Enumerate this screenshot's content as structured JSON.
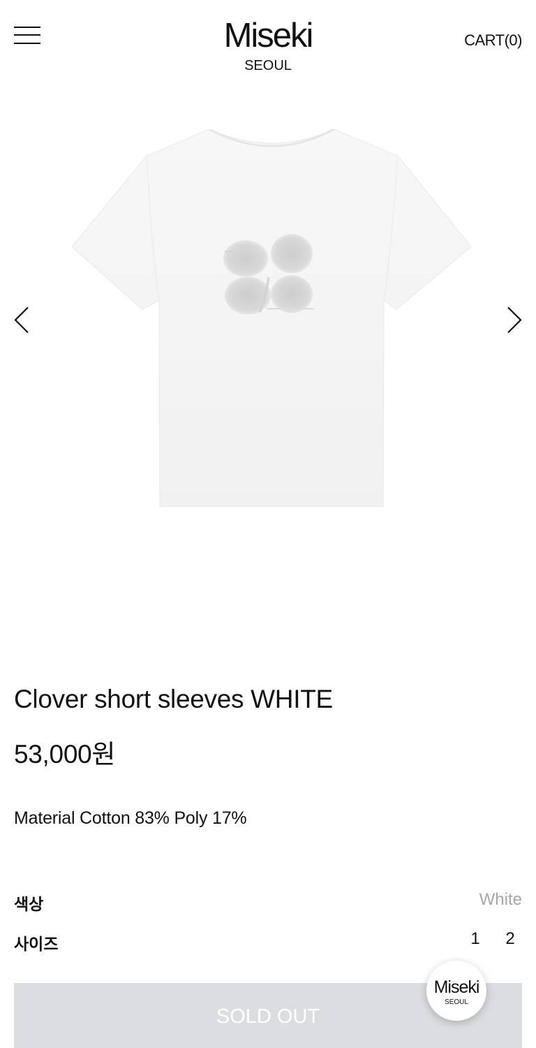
{
  "header": {
    "menu_icon": "hamburger-menu-icon",
    "logo_main": "Miseki",
    "logo_sub": "SEOUL",
    "cart_label": "CART",
    "cart_count": "(0)"
  },
  "gallery": {
    "prev_icon": "chevron-left-icon",
    "next_icon": "chevron-right-icon",
    "image": "white-tshirt-clover-print"
  },
  "product": {
    "title": "Clover short sleeves WHITE",
    "price": "53,000원",
    "material": "Material Cotton 83% Poly 17%"
  },
  "options": {
    "color_label": "색상",
    "color_value": "White",
    "size_label": "사이즈",
    "sizes": [
      "1",
      "2"
    ]
  },
  "cta": {
    "soldout_label": "SOLD OUT"
  },
  "floating_badge": {
    "main": "Miseki",
    "sub": "SEOUL"
  },
  "colors": {
    "text": "#111111",
    "muted": "#a6a6a6",
    "soldout_bg": "#dcdde0",
    "soldout_text": "#ffffff"
  }
}
